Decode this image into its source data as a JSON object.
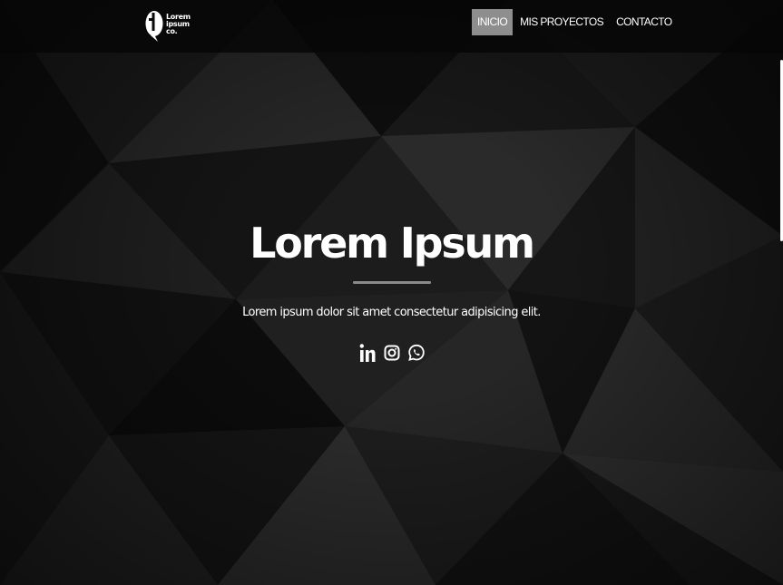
{
  "brand": {
    "logo_icon": "brand-logo-icon",
    "line1": "Lorem",
    "line2": "ipsum",
    "line3": "co."
  },
  "nav": {
    "items": [
      {
        "label": "INICIO",
        "active": true
      },
      {
        "label": "MIS PROYECTOS",
        "active": false
      },
      {
        "label": "CONTACTO",
        "active": false
      }
    ]
  },
  "hero": {
    "title": "Lorem Ipsum",
    "subtitle": "Lorem ipsum dolor sit amet consectetur adipisicing elit."
  },
  "social": {
    "icons": [
      "linkedin-icon",
      "instagram-icon",
      "whatsapp-icon"
    ]
  },
  "colors": {
    "background": "#0b0b0b",
    "nav_active": "#8e8e8e",
    "divider": "#8a8a8a",
    "text": "#ffffff"
  }
}
